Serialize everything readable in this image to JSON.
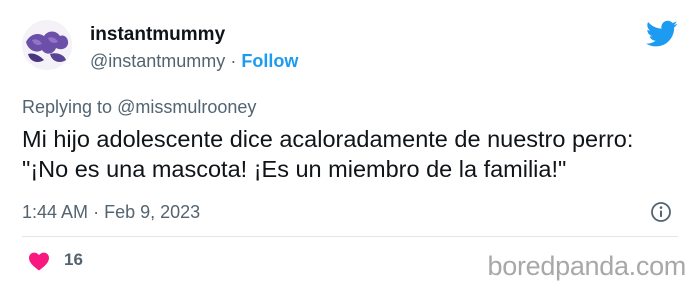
{
  "tweet": {
    "user": {
      "display_name": "instantmummy",
      "handle": "@instantmummy",
      "separator": "·",
      "follow_label": "Follow"
    },
    "replying_prefix": "Replying to",
    "replying_to": "@missmulrooney",
    "body_lines": [
      "Mi hijo adolescente dice acaloradamente de nuestro perro:",
      "\"¡No es una mascota! ¡Es un miembro de la familia!\""
    ],
    "time": "1:44 AM",
    "date_separator": "·",
    "date": "Feb 9, 2023",
    "like_count": "16"
  },
  "watermark": "boredpanda.com",
  "icons": {
    "logo": "twitter-bird-icon",
    "info": "info-icon",
    "like": "heart-icon"
  },
  "colors": {
    "accent": "#1d9bf0",
    "like": "#f91880",
    "text_primary": "#0f1419",
    "text_secondary": "#536471"
  }
}
